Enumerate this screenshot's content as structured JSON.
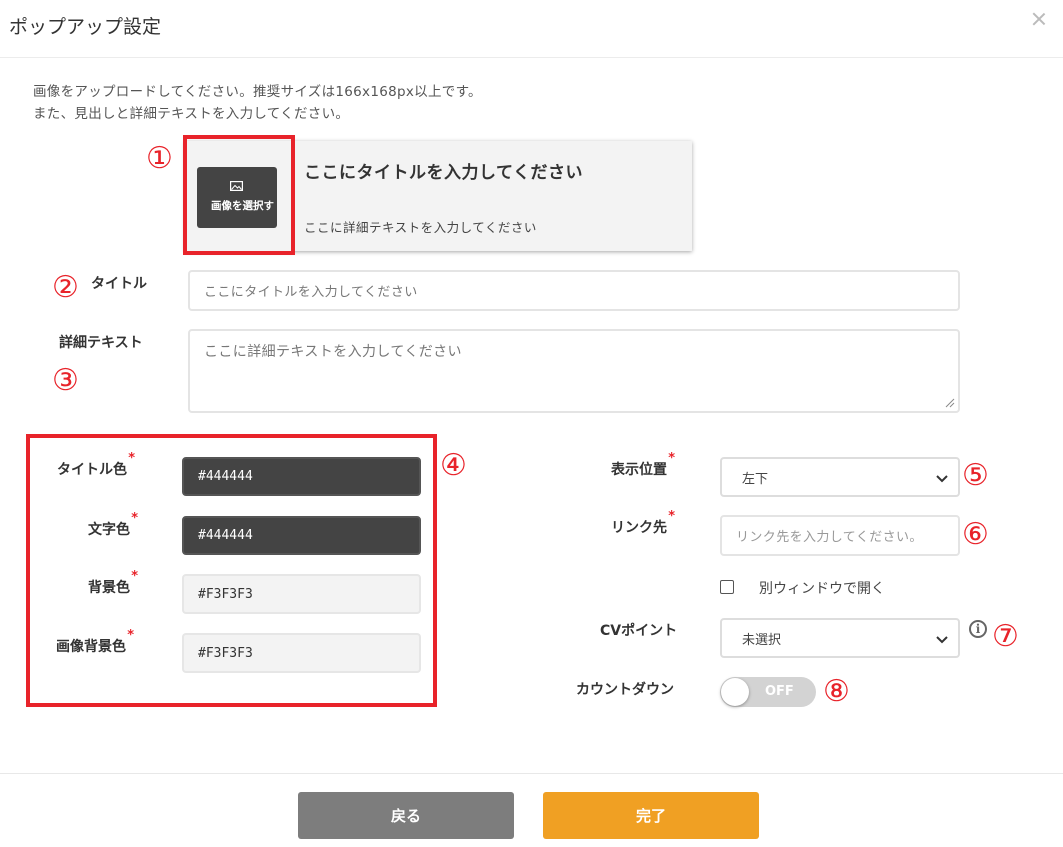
{
  "dialog": {
    "title": "ポップアップ設定",
    "description_line1": "画像をアップロードしてください。推奨サイズは166x168px以上です。",
    "description_line2": "また、見出しと詳細テキストを入力してください。"
  },
  "preview": {
    "image_button_label": "画像を選択す",
    "title": "ここにタイトルを入力してください",
    "text": "ここに詳細テキストを入力してください"
  },
  "markers": [
    "①",
    "②",
    "③",
    "④",
    "⑤",
    "⑥",
    "⑦",
    "⑧"
  ],
  "form": {
    "title_label": "タイトル",
    "title_placeholder": "ここにタイトルを入力してください",
    "detail_label": "詳細テキスト",
    "detail_placeholder": "ここに詳細テキストを入力してください",
    "required_mark": "*",
    "title_color_label": "タイトル色",
    "title_color_value": "#444444",
    "text_color_label": "文字色",
    "text_color_value": "#444444",
    "bg_color_label": "背景色",
    "bg_color_value": "#F3F3F3",
    "image_bg_color_label": "画像背景色",
    "image_bg_color_value": "#F3F3F3",
    "position_label": "表示位置",
    "position_value": "左下",
    "link_label": "リンク先",
    "link_placeholder": "リンク先を入力してください。",
    "new_window_label": "別ウィンドウで開く",
    "cv_label": "CVポイント",
    "cv_value": "未選択",
    "countdown_label": "カウントダウン",
    "countdown_state": "OFF"
  },
  "buttons": {
    "back": "戻る",
    "done": "完了"
  },
  "colors": {
    "accent": "#f0a023",
    "back_button": "#7d7d7d",
    "annotation_red": "#e8232a",
    "dark_swatch": "#444444",
    "light_swatch": "#F3F3F3"
  },
  "icons": [
    "close-icon",
    "image-icon",
    "chevron-down-icon",
    "info-icon",
    "resize-grip-icon"
  ]
}
